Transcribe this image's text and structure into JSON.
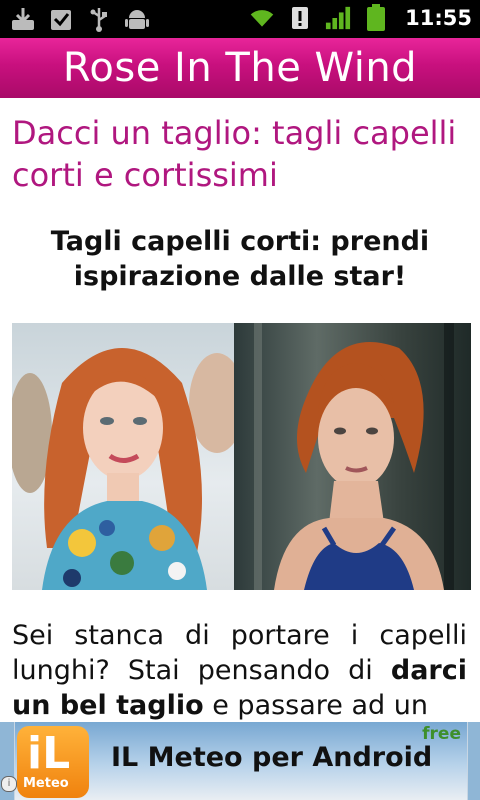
{
  "status_bar": {
    "time": "11:55",
    "left_icons": [
      "download-icon",
      "task-check-icon",
      "usb-icon",
      "android-debug-icon"
    ],
    "right_icons": [
      "wifi-icon",
      "alert-icon",
      "signal-icon",
      "battery-icon"
    ]
  },
  "app": {
    "title": "Rose In The Wind",
    "accent": "#c8107e"
  },
  "article": {
    "title": "Dacci un taglio: tagli capelli corti e cortissimi",
    "subtitle": "Tagli capelli corti: prendi ispirazione dalle star!",
    "body_part1": "Sei stanca di portare i capelli lunghi? Stai pensando di ",
    "body_bold": "darci un bel taglio",
    "body_part2": " e passare ad un"
  },
  "ad": {
    "logo_letters": "iL",
    "logo_caption": "Meteo",
    "text": "IL Meteo per Android",
    "badge": "free",
    "info_glyph": "i"
  }
}
